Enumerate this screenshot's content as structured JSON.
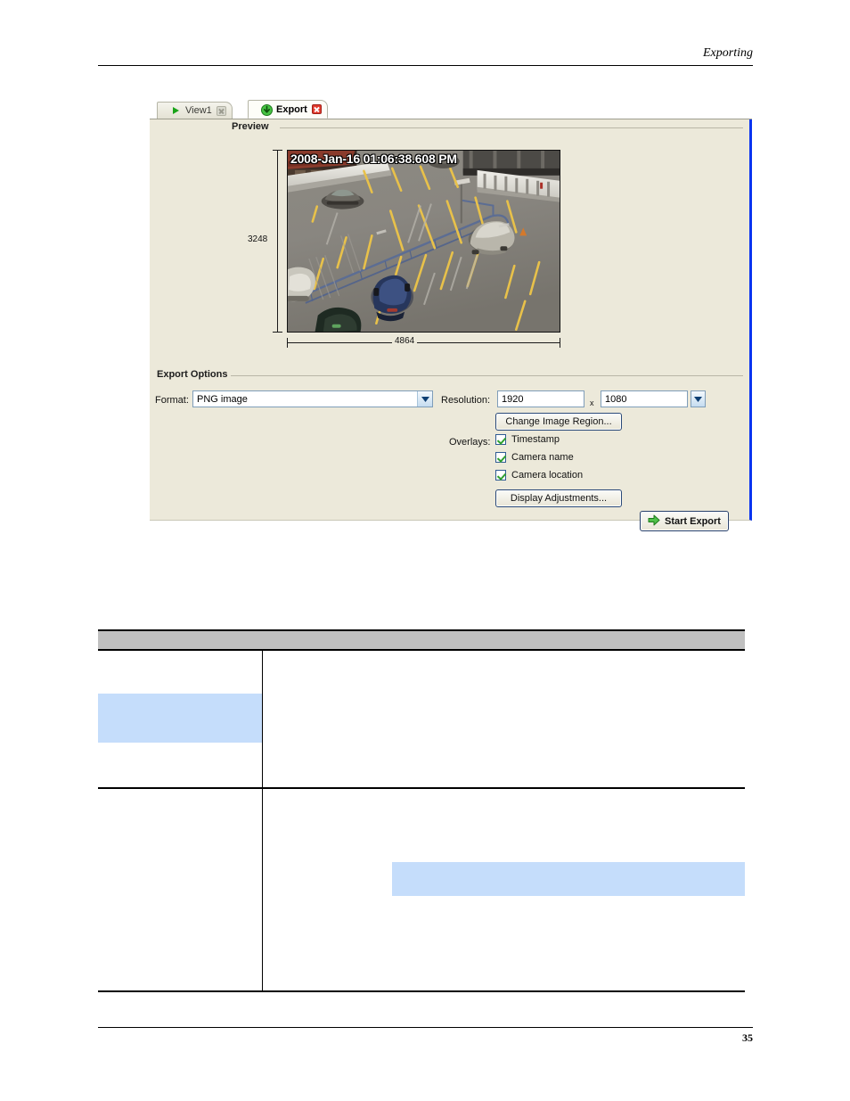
{
  "document": {
    "header_title": "Exporting",
    "page_number": "35"
  },
  "app": {
    "tabs": [
      {
        "label": "View1",
        "icon": "play-triangle-icon",
        "active": false,
        "close_icon": "close-icon-gray"
      },
      {
        "label": "Export",
        "icon": "download-arrow-icon",
        "active": true,
        "close_icon": "close-icon-red"
      }
    ],
    "preview": {
      "group_label": "Preview",
      "timestamp_overlay": "2008-Jan-16 01:06:38.608 PM",
      "height_label": "3248",
      "width_label": "4864",
      "scene_description": "overhead parking lot camera view"
    },
    "export_options": {
      "group_label": "Export Options",
      "format_label": "Format:",
      "format_value": "PNG image",
      "resolution_label": "Resolution:",
      "resolution_width": "1920",
      "resolution_separator": "x",
      "resolution_height": "1080",
      "change_image_region_button": "Change Image Region...",
      "overlays_label": "Overlays:",
      "overlays": [
        {
          "label": "Timestamp",
          "checked": true
        },
        {
          "label": "Camera name",
          "checked": true
        },
        {
          "label": "Camera location",
          "checked": true
        }
      ],
      "display_adjustments_button": "Display Adjustments...",
      "start_export_button": "Start Export"
    },
    "colors": {
      "panel_background": "#ece9da",
      "panel_accent_border": "#0a34f0",
      "control_border": "#7f9db9",
      "check_green": "#2fa02f",
      "close_red": "#e23b2e"
    }
  },
  "table": {
    "header_cells": [
      "",
      ""
    ],
    "rows": [
      {
        "left": "",
        "right": "",
        "left_highlight": true,
        "right_highlight": false
      },
      {
        "left": "",
        "right": "",
        "left_highlight": false,
        "right_highlight": true
      }
    ]
  }
}
